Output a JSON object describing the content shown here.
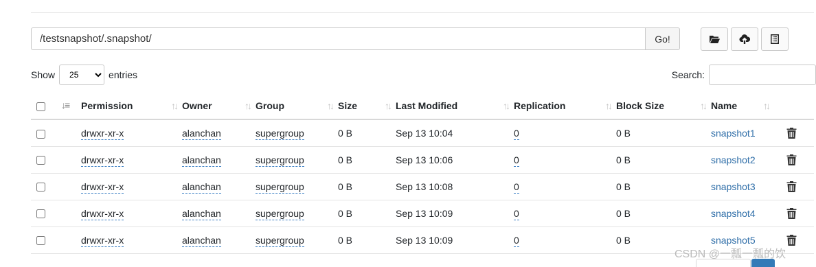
{
  "path": {
    "value": "/testsnapshot/.snapshot/",
    "go_label": "Go!"
  },
  "toolbar": {
    "icons": [
      "folder-open-icon",
      "upload-cloud-icon",
      "list-icon"
    ]
  },
  "length": {
    "show_label": "Show",
    "selected": "25",
    "entries_label": "entries"
  },
  "search": {
    "label": "Search:",
    "value": ""
  },
  "table": {
    "headers": [
      "Permission",
      "Owner",
      "Group",
      "Size",
      "Last Modified",
      "Replication",
      "Block Size",
      "Name"
    ],
    "rows": [
      {
        "permission": "drwxr-xr-x",
        "owner": "alanchan",
        "group": "supergroup",
        "size": "0 B",
        "modified": "Sep 13 10:04",
        "replication": "0",
        "block_size": "0 B",
        "name": "snapshot1"
      },
      {
        "permission": "drwxr-xr-x",
        "owner": "alanchan",
        "group": "supergroup",
        "size": "0 B",
        "modified": "Sep 13 10:06",
        "replication": "0",
        "block_size": "0 B",
        "name": "snapshot2"
      },
      {
        "permission": "drwxr-xr-x",
        "owner": "alanchan",
        "group": "supergroup",
        "size": "0 B",
        "modified": "Sep 13 10:08",
        "replication": "0",
        "block_size": "0 B",
        "name": "snapshot3"
      },
      {
        "permission": "drwxr-xr-x",
        "owner": "alanchan",
        "group": "supergroup",
        "size": "0 B",
        "modified": "Sep 13 10:09",
        "replication": "0",
        "block_size": "0 B",
        "name": "snapshot4"
      },
      {
        "permission": "drwxr-xr-x",
        "owner": "alanchan",
        "group": "supergroup",
        "size": "0 B",
        "modified": "Sep 13 10:09",
        "replication": "0",
        "block_size": "0 B",
        "name": "snapshot5"
      }
    ]
  },
  "watermark": "CSDN @一瓢一瓢的饮",
  "colors": {
    "link": "#2f6ea8",
    "page_active": "#337ab7"
  }
}
